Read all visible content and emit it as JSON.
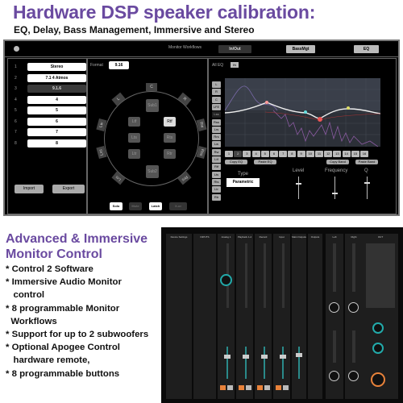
{
  "heading": {
    "title": "Hardware DSP speaker calibration:",
    "subtitle": "EQ, Delay, Bass Management, Immersive and Stereo"
  },
  "window": {
    "monitor_workflows_label": "Monitor Workflows",
    "tabs": [
      {
        "label": "In/Out",
        "selected": true
      },
      {
        "label": "BassMgt",
        "selected": false
      },
      {
        "label": "EQ",
        "selected": false
      }
    ]
  },
  "workflows": {
    "items": [
      {
        "num": "1",
        "label": "Stereo",
        "selected": false
      },
      {
        "num": "2",
        "label": "7.1 4 Atmos",
        "selected": false
      },
      {
        "num": "3",
        "label": "9.1.6",
        "selected": true
      },
      {
        "num": "4",
        "label": "4",
        "selected": false
      },
      {
        "num": "5",
        "label": "5",
        "selected": false
      },
      {
        "num": "6",
        "label": "6",
        "selected": false
      },
      {
        "num": "7",
        "label": "7",
        "selected": false
      },
      {
        "num": "8",
        "label": "8",
        "selected": false
      }
    ],
    "import_label": "Import",
    "export_label": "Export"
  },
  "format": {
    "label": "Format",
    "value": "9.16",
    "outer_speakers": [
      "C",
      "R",
      "Rw",
      "Rss",
      "Rrs",
      "Lrs",
      "Lss",
      "Lw",
      "L"
    ],
    "inner_channels": [
      {
        "label": "Sub1",
        "selected": false
      },
      {
        "label": "Ltf",
        "selected": false
      },
      {
        "label": "Rtf",
        "selected": true
      },
      {
        "label": "Lts",
        "selected": false
      },
      {
        "label": "Rts",
        "selected": false
      },
      {
        "label": "Ltr",
        "selected": false
      },
      {
        "label": "Rtr",
        "selected": false
      },
      {
        "label": "Sub2",
        "selected": false
      }
    ],
    "modes": [
      {
        "label": "Solo",
        "active": true
      },
      {
        "label": "Mute",
        "active": false
      },
      {
        "label": "Latch",
        "active": true
      },
      {
        "label": "X-or",
        "active": false
      }
    ]
  },
  "eq": {
    "all_eq_label": "All EQ",
    "in_label": "IN",
    "channels": [
      "L",
      "R",
      "C",
      "LFE",
      "Lss",
      "Rss",
      "Lrs",
      "Rrs",
      "Lw",
      "Rw",
      "Ltf",
      "Rtf",
      "Lts",
      "Rts",
      "Ltr",
      "Rtr"
    ],
    "selected_channel": "Lss",
    "bands": [
      "1",
      "2",
      "3",
      "4",
      "5",
      "6",
      "7",
      "8",
      "9",
      "10",
      "11",
      "12",
      "13",
      "14",
      "15",
      "16"
    ],
    "selected_band": "2",
    "copy_eq": "Copy EQ",
    "paste_eq": "Paste EQ",
    "copy_band": "Copy Band",
    "paste_band": "Paste Band",
    "type_label": "Type",
    "type_value": "Parametric",
    "level_label": "Level",
    "frequency_label": "Frequency",
    "q_label": "Q",
    "level_value": 0.7,
    "frequency_value": 0.3,
    "q_value": 0.75
  },
  "features": {
    "title_line1": "Advanced & Immersive",
    "title_line2": "Monitor Control",
    "bullets": [
      "* Control 2 Software",
      "* Immersive Audio Monitor",
      "   control",
      "* 8 programmable Monitor",
      "  Workflows",
      "* Support for up to 2 subwoofers",
      "* Optional Apogee Control",
      "   hardware remote,",
      "* 8 programmable buttons"
    ]
  },
  "mixer": {
    "strips": [
      "Device Settings",
      "INPUTS",
      "Analog 1",
      "Playback 1-2",
      "Record",
      "Input",
      "Main Outputs",
      "Outputs",
      "Left",
      "Right",
      "OUT"
    ]
  }
}
